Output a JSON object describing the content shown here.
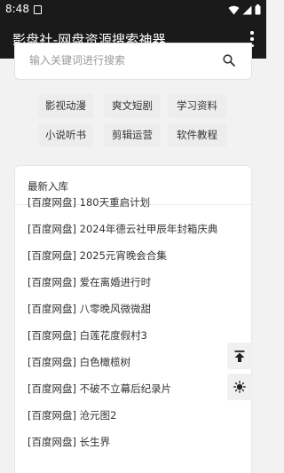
{
  "status": {
    "time": "8:48"
  },
  "app": {
    "title": "影盘社-网盘资源搜索神器"
  },
  "search": {
    "placeholder": "输入关键词进行搜索"
  },
  "categories": [
    {
      "label": "影视动漫"
    },
    {
      "label": "爽文短剧"
    },
    {
      "label": "学习资料"
    },
    {
      "label": "小说听书"
    },
    {
      "label": "剪辑运营"
    },
    {
      "label": "软件教程"
    }
  ],
  "latest": {
    "header": "最新入库",
    "items": [
      "[百度网盘] 180天重启计划",
      "[百度网盘] 2024年德云社甲辰年封箱庆典",
      "[百度网盘] 2025元宵晚会合集",
      "[百度网盘] 爱在离婚进行时",
      "[百度网盘] 八零晚风微微甜",
      "[百度网盘] 白莲花度假村3",
      "[百度网盘] 白色橄榄树",
      "[百度网盘] 不破不立幕后纪录片",
      "[百度网盘] 沧元图2",
      "[百度网盘] 长生界"
    ]
  },
  "colors": {
    "app_bar": "#1a1a1a",
    "background": "#f2f2f2",
    "chip": "#ededed"
  }
}
